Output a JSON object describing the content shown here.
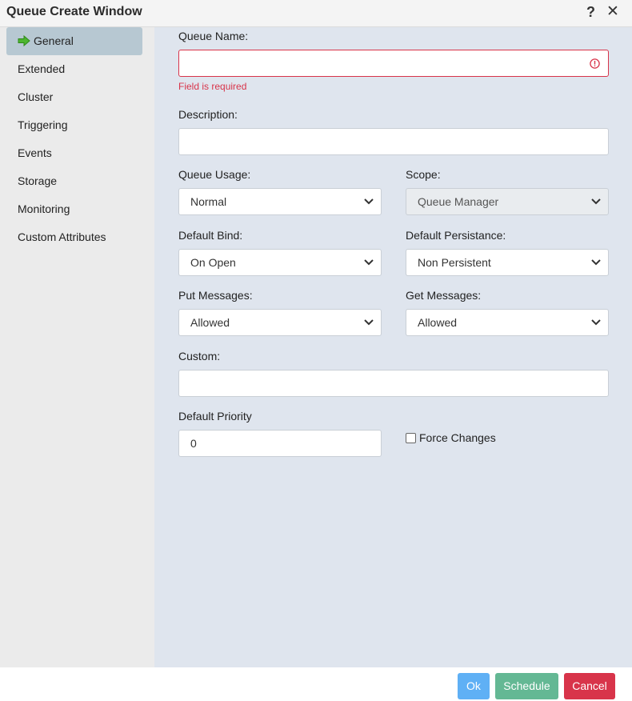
{
  "window": {
    "title": "Queue Create Window",
    "help_icon": "?",
    "close_icon": "✕"
  },
  "sidebar": {
    "items": [
      {
        "label": "General",
        "active": true
      },
      {
        "label": "Extended"
      },
      {
        "label": "Cluster"
      },
      {
        "label": "Triggering"
      },
      {
        "label": "Events"
      },
      {
        "label": "Storage"
      },
      {
        "label": "Monitoring"
      },
      {
        "label": "Custom Attributes"
      }
    ]
  },
  "form": {
    "queue_name": {
      "label": "Queue Name:",
      "value": "",
      "error": "Field is required"
    },
    "description": {
      "label": "Description:",
      "value": ""
    },
    "queue_usage": {
      "label": "Queue Usage:",
      "value": "Normal"
    },
    "scope": {
      "label": "Scope:",
      "value": "Queue Manager",
      "disabled": true
    },
    "default_bind": {
      "label": "Default Bind:",
      "value": "On Open"
    },
    "default_persistance": {
      "label": "Default Persistance:",
      "value": "Non Persistent"
    },
    "put_messages": {
      "label": "Put Messages:",
      "value": "Allowed"
    },
    "get_messages": {
      "label": "Get Messages:",
      "value": "Allowed"
    },
    "custom": {
      "label": "Custom:",
      "value": ""
    },
    "default_priority": {
      "label": "Default Priority",
      "value": "0"
    },
    "force_changes": {
      "label": "Force Changes",
      "checked": false
    }
  },
  "footer": {
    "ok_label": "Ok",
    "schedule_label": "Schedule",
    "cancel_label": "Cancel"
  },
  "colors": {
    "error": "#d8344a",
    "ok": "#5fb0f5",
    "schedule": "#64b894",
    "cancel": "#d8344a",
    "active_nav": "#b7c8d2"
  }
}
